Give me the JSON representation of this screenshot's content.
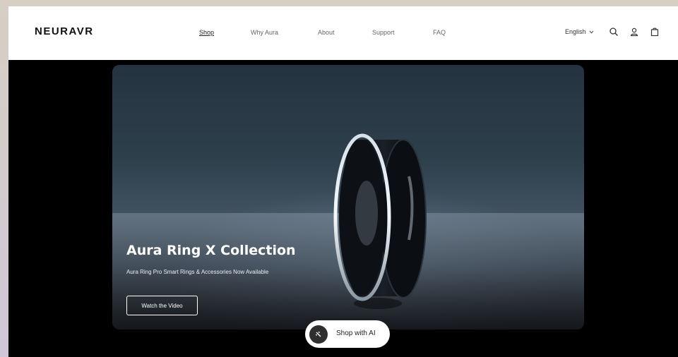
{
  "brand": {
    "logo_text": "NEURAVR"
  },
  "nav": {
    "items": [
      {
        "label": "Shop",
        "active": true
      },
      {
        "label": "Why Aura",
        "active": false
      },
      {
        "label": "About",
        "active": false
      },
      {
        "label": "Support",
        "active": false
      },
      {
        "label": "FAQ",
        "active": false
      }
    ]
  },
  "header": {
    "language": "English",
    "icons": [
      "search-icon",
      "account-icon",
      "cart-icon"
    ]
  },
  "hero": {
    "title": "Aura Ring X Collection",
    "subtitle": "Aura Ring Pro Smart Rings & Accessories Now Available",
    "button_label": "Watch the Video"
  },
  "assistant": {
    "label": "Shop with AI"
  },
  "colors": {
    "header_bg": "#ffffff",
    "page_bg": "#000000",
    "text_dark": "#111111"
  }
}
